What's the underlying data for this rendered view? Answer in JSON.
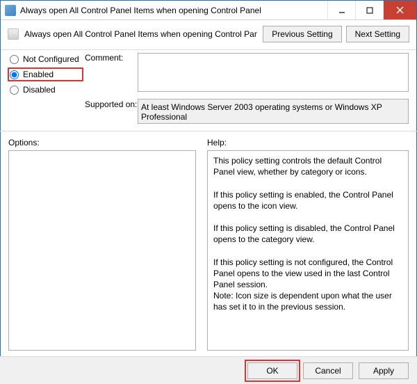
{
  "window": {
    "title": "Always open All Control Panel Items when opening Control Panel"
  },
  "header": {
    "policy_title": "Always open All Control Panel Items when opening Control Panel",
    "prev_btn": "Previous Setting",
    "next_btn": "Next Setting"
  },
  "state": {
    "not_configured": "Not Configured",
    "enabled": "Enabled",
    "disabled": "Disabled",
    "selected": "enabled"
  },
  "labels": {
    "comment": "Comment:",
    "supported": "Supported on:",
    "options": "Options:",
    "help": "Help:"
  },
  "comment_text": "",
  "supported_text": "At least Windows Server 2003 operating systems or Windows XP Professional",
  "options_text": "",
  "help_text": "This policy setting controls the default Control Panel view, whether by category or icons.\n\nIf this policy setting is enabled, the Control Panel opens to the icon view.\n\nIf this policy setting is disabled, the Control Panel opens to the category view.\n\nIf this policy setting is not configured, the Control Panel opens to the view used in the last Control Panel session.\nNote: Icon size is dependent upon what the user has set it to in the previous session.",
  "buttons": {
    "ok": "OK",
    "cancel": "Cancel",
    "apply": "Apply"
  }
}
